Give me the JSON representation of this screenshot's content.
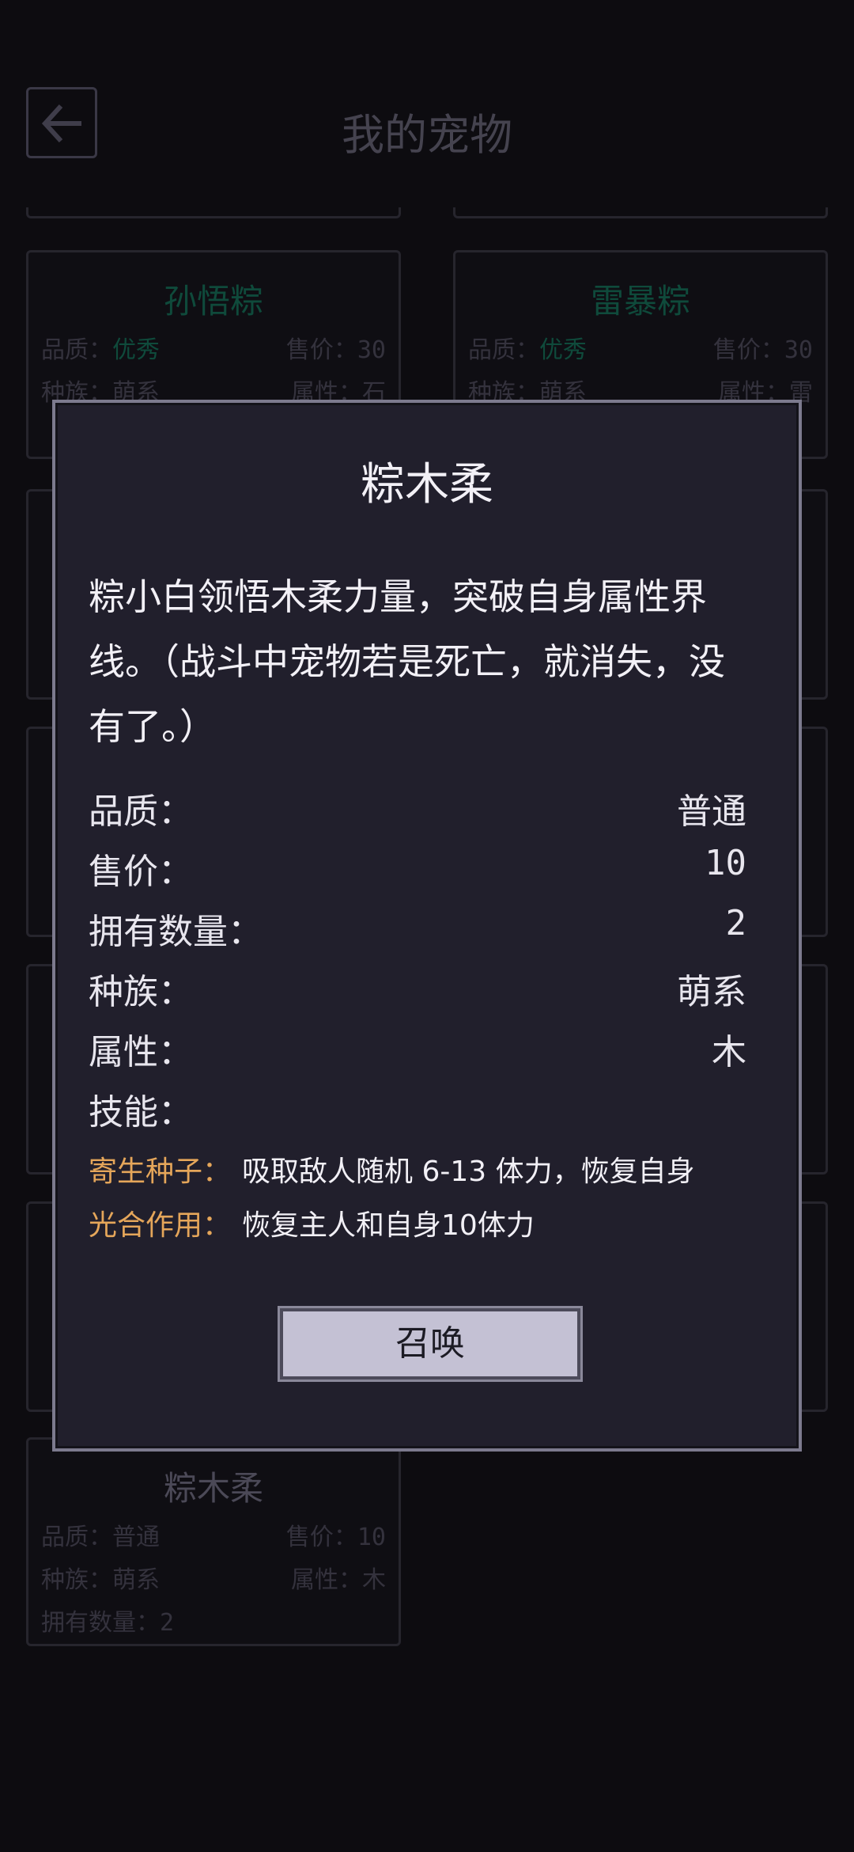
{
  "header": {
    "title": "我的宠物"
  },
  "cards": [
    {
      "name": "孙悟粽",
      "quality_label": "品质：",
      "quality": "优秀",
      "price_label": "售价：",
      "price": "30",
      "race_label": "种族：",
      "race": "萌系",
      "attr_label": "属性：",
      "attr": "石"
    },
    {
      "name": "雷暴粽",
      "quality_label": "品质：",
      "quality": "优秀",
      "price_label": "售价：",
      "price": "30",
      "race_label": "种族：",
      "race": "萌系",
      "attr_label": "属性：",
      "attr": "雷"
    },
    {
      "name": "粽木柔",
      "quality_label": "品质：",
      "quality": "普通",
      "price_label": "售价：",
      "price": "10",
      "race_label": "种族：",
      "race": "萌系",
      "attr_label": "属性：",
      "attr": "木",
      "count_label": "拥有数量：",
      "count": "2"
    }
  ],
  "modal": {
    "title": "粽木柔",
    "description": "粽小白领悟木柔力量，突破自身属性界线。（战斗中宠物若是死亡，就消失，没有了。）",
    "stats": [
      {
        "label": "品质：",
        "value": "普通"
      },
      {
        "label": "售价：",
        "value": "10"
      },
      {
        "label": "拥有数量：",
        "value": "2"
      },
      {
        "label": "种族：",
        "value": "萌系"
      },
      {
        "label": "属性：",
        "value": "木"
      }
    ],
    "skills_label": "技能：",
    "skills": [
      {
        "name": "寄生种子：",
        "desc": "吸取敌人随机 6-13 体力，恢复自身"
      },
      {
        "name": "光合作用：",
        "desc": "恢复主人和自身10体力"
      }
    ],
    "summon_label": "召唤"
  },
  "colors": {
    "accent_skill": "#e5a65a",
    "good_quality": "#0f4a3b",
    "modal_bg": "#211f2c"
  }
}
